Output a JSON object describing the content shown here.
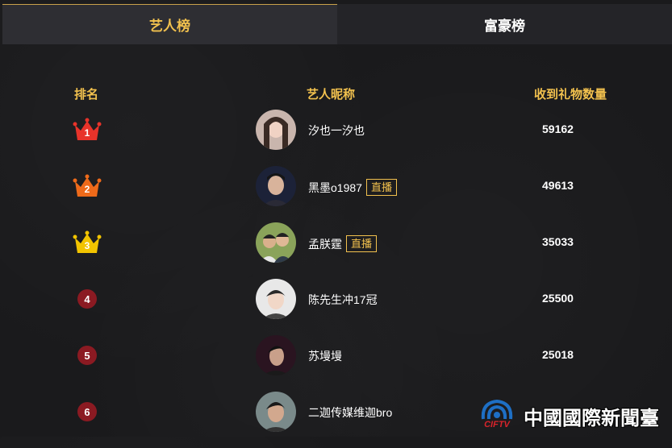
{
  "tabs": [
    {
      "label": "艺人榜",
      "active": true
    },
    {
      "label": "富豪榜",
      "active": false
    }
  ],
  "header": {
    "rank": "排名",
    "name": "艺人昵称",
    "gifts": "收到礼物数量"
  },
  "colors": {
    "accent": "#f2c14e",
    "crown1": "#e8332a",
    "crown2": "#ee6a1a",
    "crown3": "#f2c400",
    "rankCircle": "#8b1a22"
  },
  "rows": [
    {
      "rank": "1",
      "nickname": "汐也一汐也",
      "live": "",
      "gifts": "59162",
      "avatar": "avatar-photo"
    },
    {
      "rank": "2",
      "nickname": "黑墨o1987",
      "live": "直播",
      "gifts": "49613",
      "avatar": "avatar-photo"
    },
    {
      "rank": "3",
      "nickname": "孟朕霆",
      "live": "直播",
      "gifts": "35033",
      "avatar": "avatar-photo"
    },
    {
      "rank": "4",
      "nickname": "陈先生冲17冠",
      "live": "",
      "gifts": "25500",
      "avatar": "avatar-photo"
    },
    {
      "rank": "5",
      "nickname": "苏墁墁",
      "live": "",
      "gifts": "25018",
      "avatar": "avatar-photo"
    },
    {
      "rank": "6",
      "nickname": "二迦传媒维迦bro",
      "live": "",
      "gifts": "",
      "avatar": "avatar-photo"
    }
  ],
  "watermark": {
    "logo_text": "CIFTV",
    "text": "中國國際新聞臺"
  }
}
